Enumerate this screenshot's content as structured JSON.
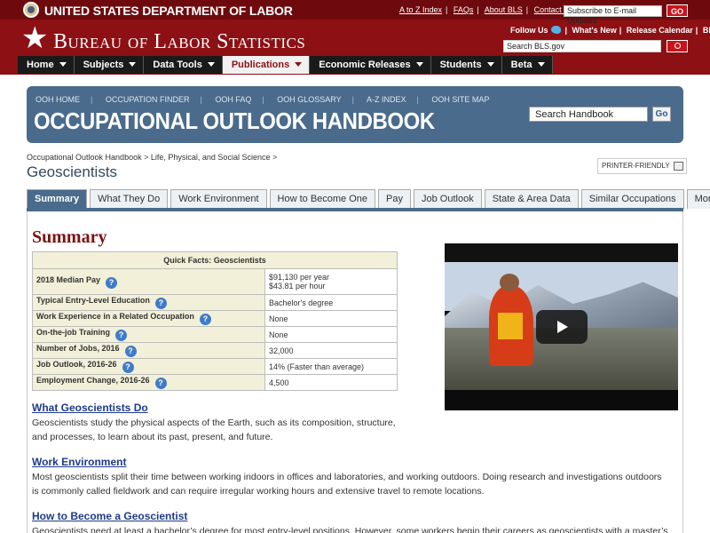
{
  "dol": {
    "name": "UNITED STATES DEPARTMENT OF LABOR",
    "util_links": [
      "A to Z Index",
      "FAQs",
      "About BLS",
      "Contact Us"
    ],
    "email_placeholder": "Subscribe to E-mail Updates",
    "go_label": "GO"
  },
  "bls": {
    "name": "Bureau of Labor Statistics",
    "follow_us": "Follow Us",
    "links": [
      "What's New",
      "Release Calendar",
      "Blog"
    ],
    "search_placeholder": "Search BLS.gov"
  },
  "nav": [
    {
      "label": "Home",
      "active": false
    },
    {
      "label": "Subjects",
      "active": false
    },
    {
      "label": "Data Tools",
      "active": false
    },
    {
      "label": "Publications",
      "active": true
    },
    {
      "label": "Economic Releases",
      "active": false
    },
    {
      "label": "Students",
      "active": false
    },
    {
      "label": "Beta",
      "active": false
    }
  ],
  "ooh": {
    "links": [
      "OOH HOME",
      "OCCUPATION FINDER",
      "OOH FAQ",
      "OOH GLOSSARY",
      "A-Z INDEX",
      "OOH SITE MAP"
    ],
    "title": "OCCUPATIONAL OUTLOOK HANDBOOK",
    "search_value": "Search Handbook",
    "go_label": "Go"
  },
  "breadcrumb": {
    "root": "Occupational Outlook Handbook",
    "section": "Life, Physical, and Social Science",
    "sep": ">"
  },
  "page_title": "Geoscientists",
  "printer_friendly": "PRINTER-FRIENDLY",
  "tabs": [
    {
      "label": "Summary",
      "active": true
    },
    {
      "label": "What They Do",
      "active": false
    },
    {
      "label": "Work Environment",
      "active": false
    },
    {
      "label": "How to Become One",
      "active": false
    },
    {
      "label": "Pay",
      "active": false
    },
    {
      "label": "Job Outlook",
      "active": false
    },
    {
      "label": "State & Area Data",
      "active": false
    },
    {
      "label": "Similar Occupations",
      "active": false
    },
    {
      "label": "More Info",
      "active": false
    }
  ],
  "summary": {
    "heading": "Summary",
    "table_title": "Quick Facts: Geoscientists",
    "rows": [
      {
        "label": "2018 Median Pay",
        "value": "$91,130 per year",
        "value2": "$43.81 per hour"
      },
      {
        "label": "Typical Entry-Level Education",
        "value": "Bachelor's degree"
      },
      {
        "label": "Work Experience in a Related Occupation",
        "value": "None"
      },
      {
        "label": "On-the-job Training",
        "value": "None"
      },
      {
        "label": "Number of Jobs, 2016",
        "value": "32,000"
      },
      {
        "label": "Job Outlook, 2016-26",
        "value": "14% (Faster than average)"
      },
      {
        "label": "Employment Change, 2016-26",
        "value": "4,500"
      }
    ],
    "help_glyph": "?"
  },
  "sections": [
    {
      "title": "What Geoscientists Do",
      "body": "Geoscientists study the physical aspects of the Earth, such as its composition, structure, and processes, to learn about its past, present, and future."
    },
    {
      "title": "Work Environment",
      "body": "Most geoscientists split their time between working indoors in offices and laboratories, and working outdoors. Doing research and investigations outdoors is commonly called fieldwork and can require irregular working hours and extensive travel to remote locations."
    },
    {
      "title": "How to Become a Geoscientist",
      "body": "Geoscientists need at least a bachelor’s degree for most entry-level positions. However, some workers begin their careers as geoscientists with a master’s"
    }
  ],
  "colors": {
    "header_red": "#8c1014",
    "ooh_blue": "#4a6b8c",
    "heading_red": "#7c1111",
    "link_blue": "#1e3a8a"
  }
}
